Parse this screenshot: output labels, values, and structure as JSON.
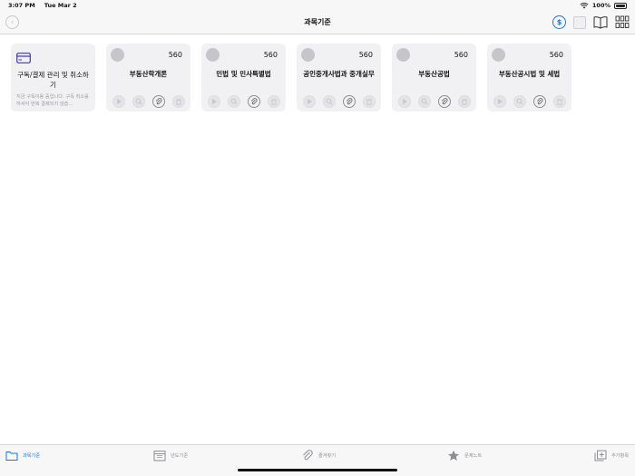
{
  "status_bar": {
    "time": "3:07 PM",
    "date": "Tue Mar 2",
    "battery_text": "100%"
  },
  "nav": {
    "title": "과목기준",
    "dollar_symbol": "$"
  },
  "subscription_card": {
    "title": "구독/결제 관리 및 취소하기",
    "description": "지금 구독이용 중입니다. 구독 취소를 하셔야 번복 결제되지 않습..."
  },
  "subjects": [
    {
      "name": "부동산학개론",
      "count": "560"
    },
    {
      "name": "민법 및 민사특별법",
      "count": "560"
    },
    {
      "name": "공인중개사법과 중개실무",
      "count": "560"
    },
    {
      "name": "부동산공법",
      "count": "560"
    },
    {
      "name": "부동산공시법 및 세법",
      "count": "560"
    }
  ],
  "tabs": [
    {
      "label": "과목기준",
      "icon": "folder-icon",
      "active": true
    },
    {
      "label": "년도기준",
      "icon": "calendar-icon",
      "active": false
    },
    {
      "label": "즐겨찾기",
      "icon": "paperclip-icon",
      "active": false
    },
    {
      "label": "문제노트",
      "icon": "star-icon",
      "active": false
    },
    {
      "label": "추가항목",
      "icon": "add-square-icon",
      "active": false
    }
  ],
  "colors": {
    "accent": "#1a73e8",
    "card_bg": "#f1f1f3",
    "inactive": "#8e8e93"
  }
}
